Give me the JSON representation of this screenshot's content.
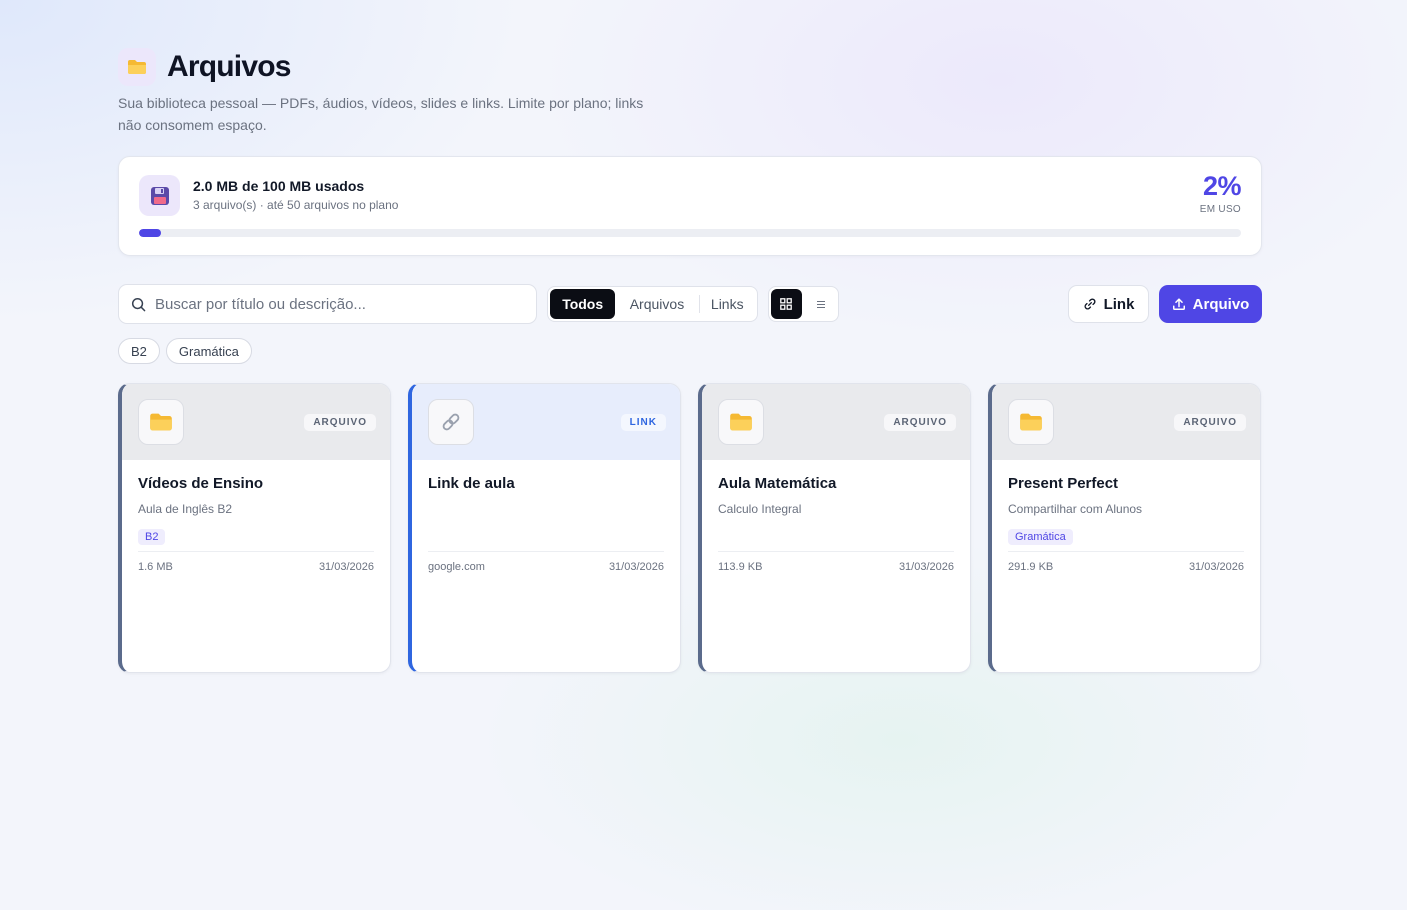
{
  "header": {
    "title": "Arquivos",
    "subtitle": "Sua biblioteca pessoal — PDFs, áudios, vídeos, slides e links. Limite por plano; links não consomem espaço."
  },
  "storage": {
    "title": "2.0 MB de 100 MB usados",
    "subtitle": "3 arquivo(s) · até 50 arquivos no plano",
    "percent": "2%",
    "percent_label": "EM USO",
    "usage_fraction": 0.02
  },
  "search": {
    "placeholder": "Buscar por título ou descrição..."
  },
  "filter": {
    "tabs": [
      "Todos",
      "Arquivos",
      "Links"
    ],
    "active": "Todos"
  },
  "view_toggle": {
    "active": "grid-view-icon",
    "options": [
      "grid-view-icon",
      "list-view-icon"
    ]
  },
  "actions": {
    "link_label": "Link",
    "upload_label": "Arquivo"
  },
  "tag_filters": [
    "B2",
    "Gramática"
  ],
  "colors": {
    "accent": "#4f46e5",
    "link_accent": "#2f66e0",
    "file_accent": "#5b6b8c",
    "folder": "#f5c04a"
  },
  "cards": [
    {
      "type": "file",
      "badge": "ARQUIVO",
      "icon": "folder-icon",
      "title": "Vídeos de Ensino",
      "description": "Aula de Inglês B2",
      "tag": "B2",
      "size": "1.6 MB",
      "date": "31/03/2026"
    },
    {
      "type": "link",
      "badge": "LINK",
      "icon": "link-icon",
      "title": "Link de aula",
      "description": "",
      "tag": "",
      "size": "google.com",
      "date": "31/03/2026"
    },
    {
      "type": "file",
      "badge": "ARQUIVO",
      "icon": "folder-icon",
      "title": "Aula Matemática",
      "description": "Calculo Integral",
      "tag": "",
      "size": "113.9 KB",
      "date": "31/03/2026"
    },
    {
      "type": "file",
      "badge": "ARQUIVO",
      "icon": "folder-icon",
      "title": "Present Perfect",
      "description": "Compartilhar com Alunos",
      "tag": "Gramática",
      "size": "291.9 KB",
      "date": "31/03/2026"
    }
  ]
}
